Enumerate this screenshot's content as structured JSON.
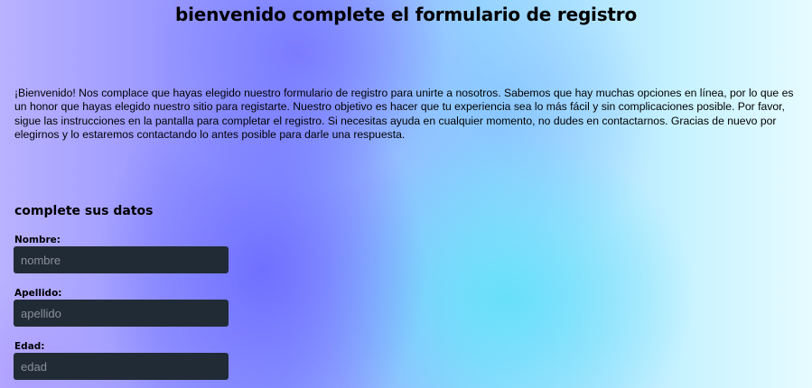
{
  "header": {
    "title": "bienvenido complete el formulario de registro"
  },
  "intro": {
    "text": "¡Bienvenido! Nos complace que hayas elegido nuestro formulario de registro para unirte a nosotros. Sabemos que hay muchas opciones en línea, por lo que es un honor que hayas elegido nuestro sitio para registarte. Nuestro objetivo es hacer que tu experiencia sea lo más fácil y sin complicaciones posible. Por favor, sigue las instrucciones en la pantalla para completar el registro. Si necesitas ayuda en cualquier momento, no dudes en contactarnos. Gracias de nuevo por elegirnos y lo estaremos contactando lo antes posible para darle una respuesta."
  },
  "form": {
    "section_title": "complete sus datos",
    "fields": [
      {
        "label": "Nombre:",
        "placeholder": "nombre",
        "value": ""
      },
      {
        "label": "Apellido:",
        "placeholder": "apellido",
        "value": ""
      },
      {
        "label": "Edad:",
        "placeholder": "edad",
        "value": ""
      }
    ]
  },
  "colors": {
    "input_background": "#212b36",
    "placeholder_text": "#8a919a"
  }
}
